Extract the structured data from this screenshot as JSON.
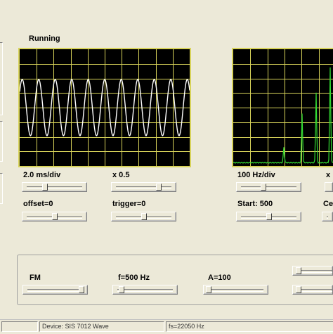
{
  "status": {
    "running": "Running"
  },
  "left_scope": {
    "timebase_label": "2.0 ms/div",
    "gain_label": "x 0.5",
    "offset_label": "offset=0",
    "trigger_label": "trigger=0"
  },
  "right_scope": {
    "freq_div_label": "100 Hz/div",
    "gain_label_partial": "x",
    "start_label": "Start: 500",
    "center_label_partial": "Ce"
  },
  "generator": {
    "fm_label": "FM",
    "freq_label": "f=500 Hz",
    "amp_label": "A=100"
  },
  "statusbar": {
    "device": "Device: SIS 7012 Wave",
    "fs": "fs=22050 Hz"
  },
  "colors": {
    "screen": "#000000",
    "grid": "#d8d35a",
    "wave": "#ffffff",
    "spectrum": "#33dd33"
  }
}
